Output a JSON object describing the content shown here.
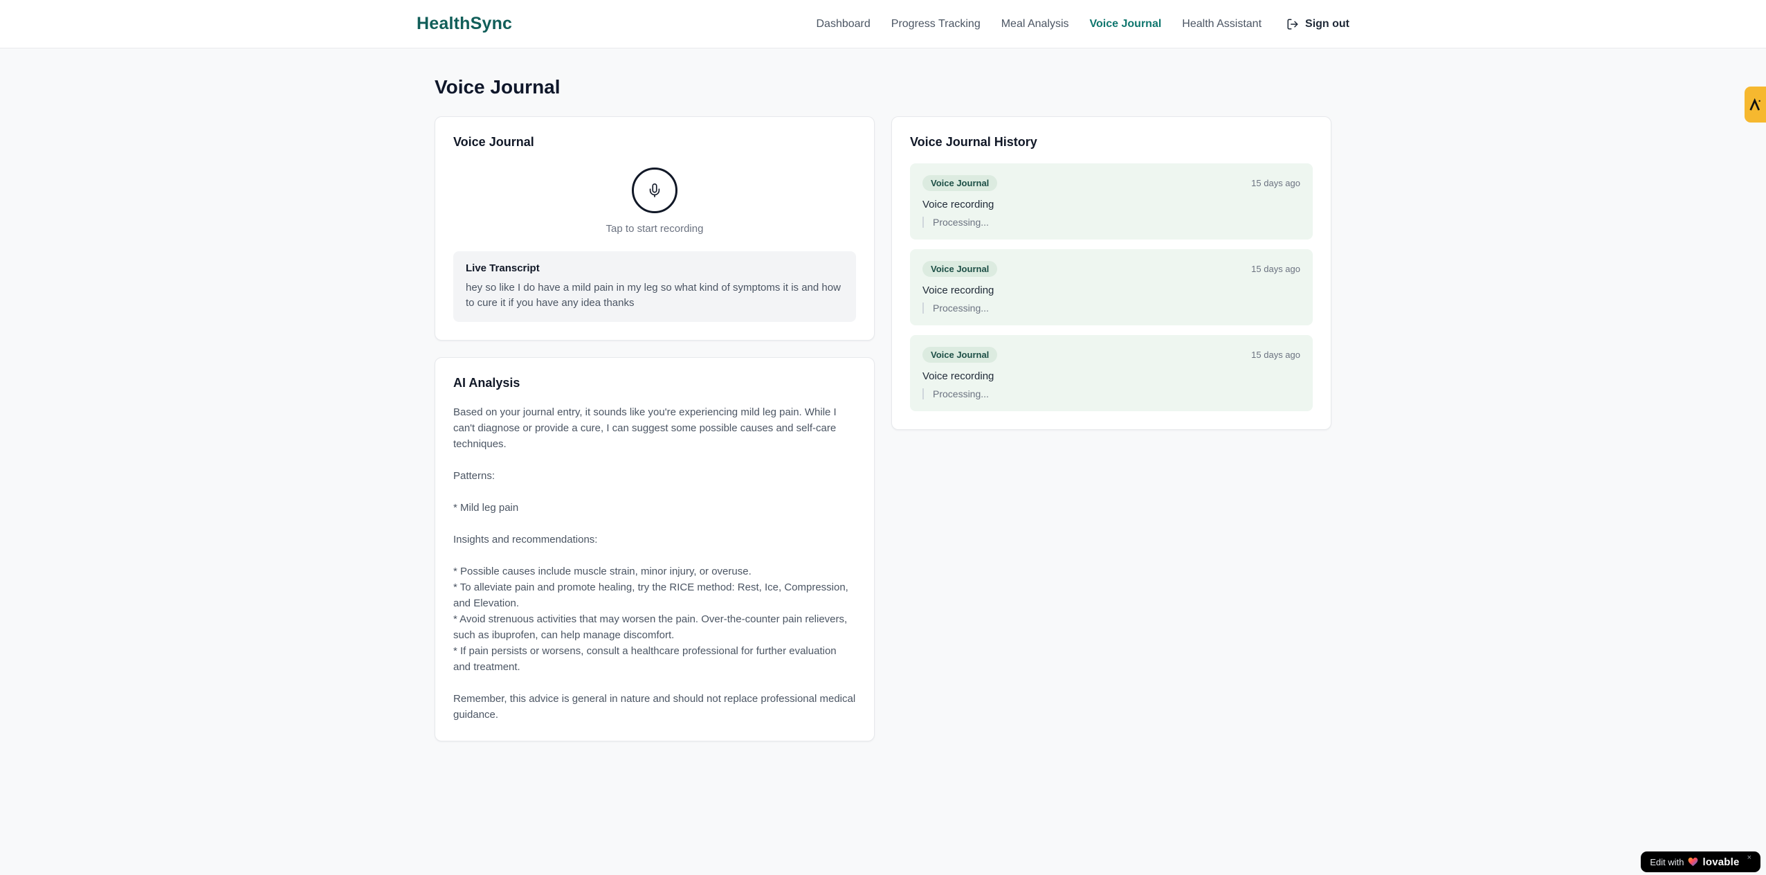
{
  "brand": {
    "name": "HealthSync",
    "color": "#115E59"
  },
  "nav": {
    "items": [
      {
        "label": "Dashboard",
        "active": false
      },
      {
        "label": "Progress Tracking",
        "active": false
      },
      {
        "label": "Meal Analysis",
        "active": false
      },
      {
        "label": "Voice Journal",
        "active": true
      },
      {
        "label": "Health Assistant",
        "active": false
      }
    ],
    "sign_out_label": "Sign out",
    "sign_out_icon": "logout-icon"
  },
  "page": {
    "title": "Voice Journal"
  },
  "recorder_card": {
    "title": "Voice Journal",
    "mic_icon": "microphone-icon",
    "tap_hint": "Tap to start recording",
    "transcript": {
      "label": "Live Transcript",
      "text": "hey so like I do have a mild pain in my leg so what kind of symptoms it is and how to cure it if you have any idea thanks"
    }
  },
  "analysis_card": {
    "title": "AI Analysis",
    "body": "Based on your journal entry, it sounds like you're experiencing mild leg pain. While I can't diagnose or provide a cure, I can suggest some possible causes and self-care techniques.\n\nPatterns:\n\n* Mild leg pain\n\nInsights and recommendations:\n\n* Possible causes include muscle strain, minor injury, or overuse.\n* To alleviate pain and promote healing, try the RICE method: Rest, Ice, Compression, and Elevation.\n* Avoid strenuous activities that may worsen the pain. Over-the-counter pain relievers, such as ibuprofen, can help manage discomfort.\n* If pain persists or worsens, consult a healthcare professional for further evaluation and treatment.\n\nRemember, this advice is general in nature and should not replace professional medical guidance."
  },
  "history_card": {
    "title": "Voice Journal History",
    "entries": [
      {
        "badge": "Voice Journal",
        "time": "15 days ago",
        "title": "Voice recording",
        "status": "Processing..."
      },
      {
        "badge": "Voice Journal",
        "time": "15 days ago",
        "title": "Voice recording",
        "status": "Processing..."
      },
      {
        "badge": "Voice Journal",
        "time": "15 days ago",
        "title": "Voice recording",
        "status": "Processing..."
      }
    ]
  },
  "widgets": {
    "side_tab": {
      "icon": "a-monogram-icon",
      "color": "#F6B82F"
    },
    "lovable_badge": {
      "prefix": "Edit with",
      "brand_label": "lovable",
      "heart_icon": "heart-icon",
      "close": "×"
    }
  },
  "colors": {
    "page_bg": "#F8F9FA",
    "nav_active": "#0F766E",
    "nav_inactive": "#4B5563",
    "entry_bg": "#EEF6F0",
    "badge_bg": "#DCEBE0",
    "badge_text": "#1D4F46",
    "transcript_bg": "#F3F4F6",
    "muted_text": "#6B7280"
  }
}
